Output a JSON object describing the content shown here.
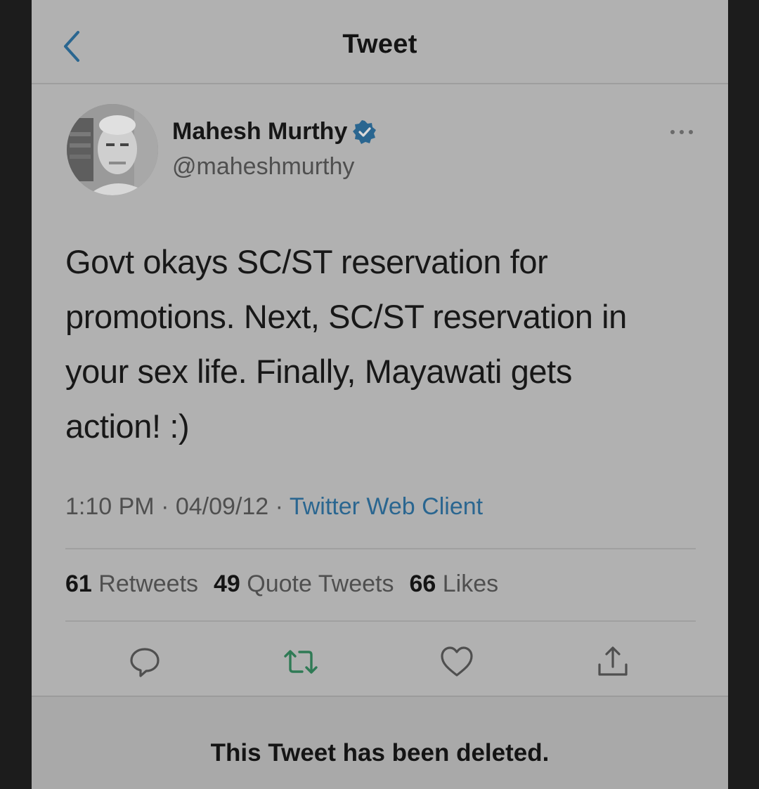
{
  "nav": {
    "title": "Tweet",
    "back_icon": "chevron-left-icon"
  },
  "author": {
    "display_name": "Mahesh Murthy",
    "handle": "@maheshmurthy",
    "verified": true
  },
  "tweet": {
    "text": "Govt okays SC/ST reservation for\npromotions. Next, SC/ST reservation in\nyour sex life. Finally, Mayawati gets\naction! :)",
    "time": "1:10 PM",
    "date": "04/09/12",
    "separator": "·",
    "client": "Twitter Web Client"
  },
  "stats": {
    "retweets_count": "61",
    "retweets_label": "Retweets",
    "quotes_count": "49",
    "quotes_label": "Quote Tweets",
    "likes_count": "66",
    "likes_label": "Likes"
  },
  "actions": [
    "reply-icon",
    "retweet-icon",
    "like-icon",
    "share-icon"
  ],
  "notice": {
    "text": "This Tweet has been deleted."
  },
  "colors": {
    "background": "#b1b1b1",
    "link": "#2a6690",
    "retweet_green": "#2f7a55",
    "verified_blue": "#2a6690"
  }
}
